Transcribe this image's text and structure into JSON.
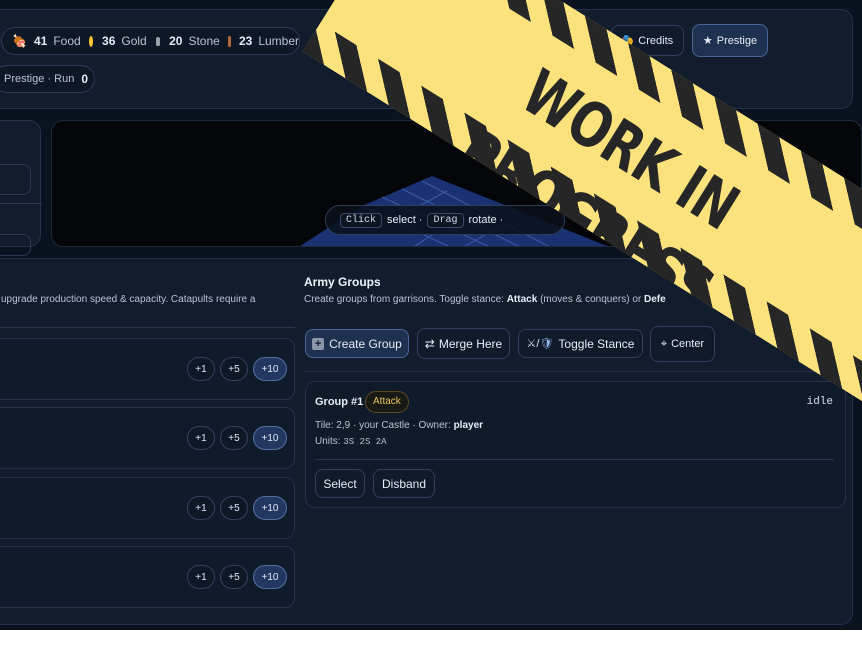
{
  "resources": {
    "food_value": "41",
    "food_label": "Food",
    "gold_value": "36",
    "gold_label": "Gold",
    "stone_value": "20",
    "stone_label": "Stone",
    "lumber_value": "23",
    "lumber_label": "Lumber"
  },
  "header": {
    "credits_label": "Credits",
    "prestige_label": "Prestige",
    "run_label": "Prestige · Run",
    "run_value": "0"
  },
  "viewport": {
    "hint_click": "Click",
    "hint_select": "select ·",
    "hint_drag": "Drag",
    "hint_rotate": "rotate ·"
  },
  "production": {
    "description": "upgrade production speed & capacity. Catapults require a",
    "rows": [
      {
        "plus1": "+1",
        "plus5": "+5",
        "plus10": "+10"
      },
      {
        "plus1": "+1",
        "plus5": "+5",
        "plus10": "+10"
      },
      {
        "plus1": "+1",
        "plus5": "+5",
        "plus10": "+10"
      },
      {
        "plus1": "+1",
        "plus5": "+5",
        "plus10": "+10"
      }
    ]
  },
  "army": {
    "title": "Army Groups",
    "subtitle_pre": "Create groups from garrisons. Toggle stance:",
    "subtitle_attack": "Attack",
    "subtitle_mid": "(moves & conquers) or",
    "subtitle_def": "Defe",
    "create_label": "Create Group",
    "merge_label": "Merge Here",
    "toggle_label": "Toggle Stance",
    "center_label": "Center",
    "group": {
      "name": "Group #1",
      "stance": "Attack",
      "state": "idle",
      "tile_text": "Tile: 2,9 · your Castle · Owner:",
      "owner": "player",
      "units_label": "Units:",
      "units": "3S 2S 2A",
      "select_label": "Select",
      "disband_label": "Disband"
    }
  },
  "banner": {
    "text": "WORK IN PROGRESS"
  },
  "colors": {
    "background": "#0a121f",
    "panel": "#111c2d",
    "accent": "#4a6796",
    "banner_yellow": "#fbe27d",
    "stance": "#e8c25a"
  }
}
